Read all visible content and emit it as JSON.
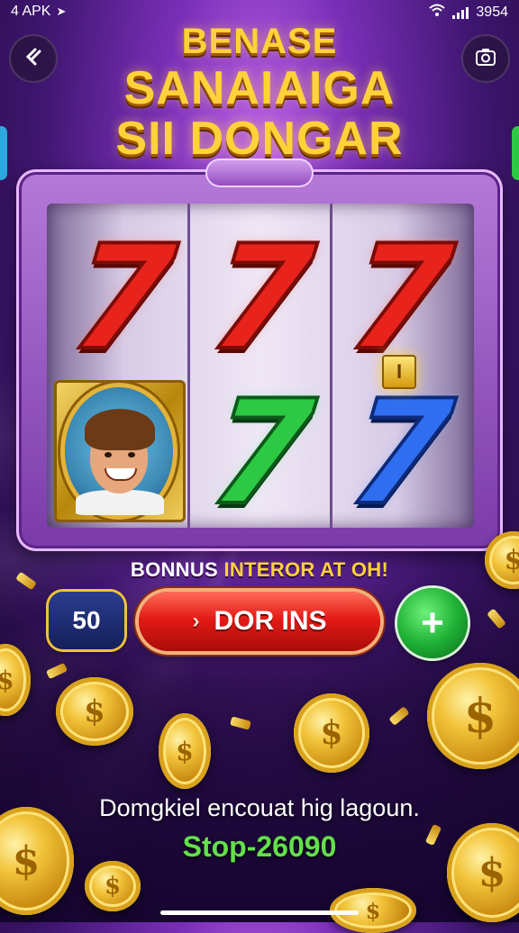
{
  "status_bar": {
    "left_text": "4 APK",
    "right_text": "3954"
  },
  "icons": {
    "back": "back-icon",
    "camera": "camera-icon",
    "wifi": "wifi-icon",
    "signal": "signal-icon",
    "navigation": "navigation-icon"
  },
  "title": {
    "line1": "BENASE",
    "line2": "SANAIAIGA",
    "line3": "SII DONGAR"
  },
  "reels": {
    "top_row": [
      "7",
      "7",
      "7"
    ],
    "bottom_row": [
      "portrait",
      "7",
      "7"
    ],
    "bonus_marker": "I"
  },
  "bonus_banner": {
    "part1": "BONNUS ",
    "part2": "INTEROR AT OH!"
  },
  "controls": {
    "bet_value": "50",
    "spin_label": "DOR INS",
    "spin_chevron": "›",
    "plus_label": "+"
  },
  "message": "Domgkiel encouat hig lagoun.",
  "stop_text": "Stop-26090",
  "colors": {
    "title_gold": "#ffd23a",
    "spin_red": "#e41b16",
    "plus_green": "#1fb236",
    "stop_green": "#63e04a",
    "bet_navy": "#14205a"
  }
}
